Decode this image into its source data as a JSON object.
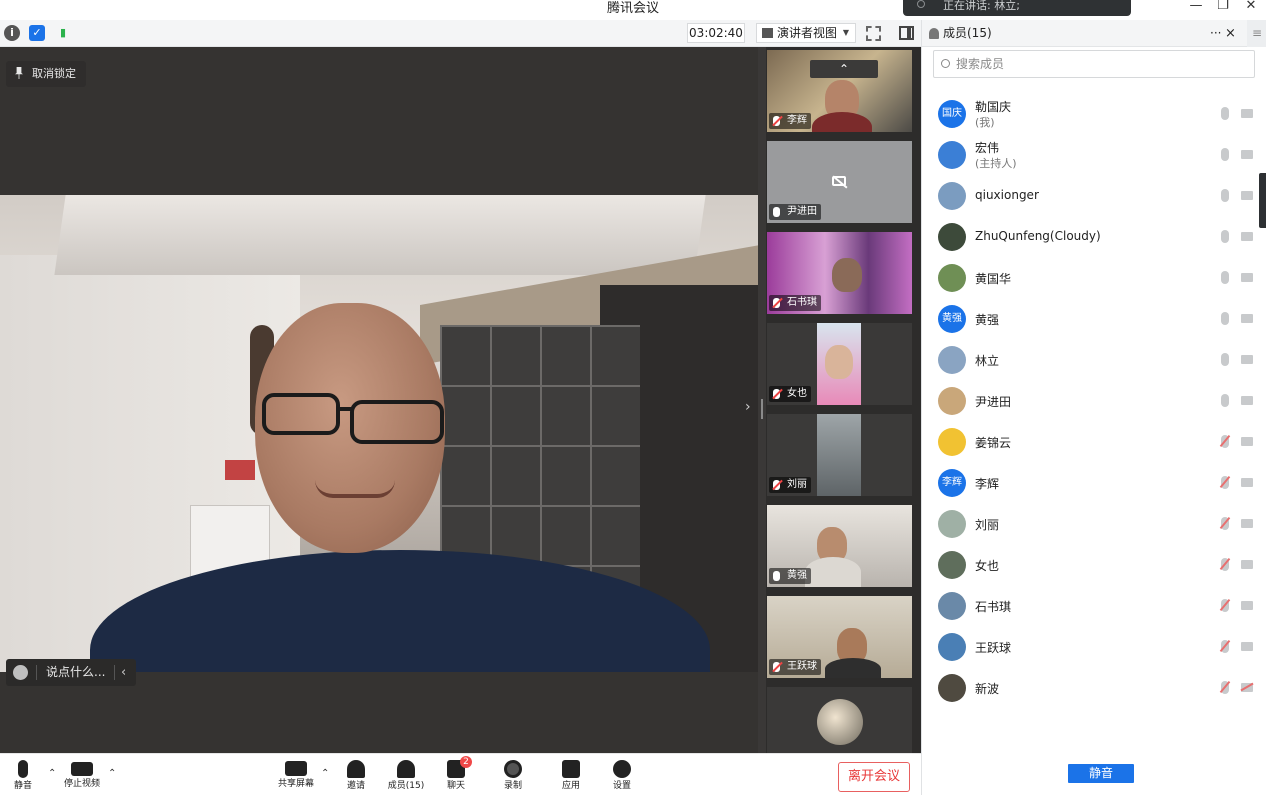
{
  "app": {
    "title": "腾讯会议",
    "speaking_text": "正在讲话: 林立;"
  },
  "toolbar": {
    "timer": "03:02:40",
    "view_mode": "演讲者视图"
  },
  "stage": {
    "unpin_label": "取消锁定",
    "chat_placeholder": "说点什么..."
  },
  "thumbnails": [
    {
      "name": "李辉",
      "mic": "muted"
    },
    {
      "name": "尹进田",
      "mic": "on"
    },
    {
      "name": "石书琪",
      "mic": "muted"
    },
    {
      "name": "女也",
      "mic": "muted"
    },
    {
      "name": "刘丽",
      "mic": "muted"
    },
    {
      "name": "黄强",
      "mic": "on"
    },
    {
      "name": "王跃球",
      "mic": "muted"
    },
    {
      "name": "",
      "mic": "on"
    }
  ],
  "bottombar": {
    "mute": "静音",
    "stop_video": "停止视频",
    "share_screen": "共享屏幕",
    "invite": "邀请",
    "members": "成员(15)",
    "chat": "聊天",
    "chat_badge": "2",
    "record": "录制",
    "apps": "应用",
    "settings": "设置",
    "leave": "离开会议"
  },
  "members_panel": {
    "title": "成员(15)",
    "more": "···",
    "close": "×",
    "menu": "≡",
    "search_placeholder": "搜索成员",
    "mute_all": "静音",
    "members": [
      {
        "name": "勒国庆",
        "role": "(我)",
        "avatar_text": "国庆",
        "avatar_color": "#1b73e8",
        "mic": "on"
      },
      {
        "name": "宏伟",
        "role": "(主持人)",
        "avatar_text": "",
        "avatar_color": "#3b7fd6",
        "mic": "on"
      },
      {
        "name": "qiuxionger",
        "role": "",
        "avatar_text": "",
        "avatar_color": "#7b9cc0",
        "mic": "on"
      },
      {
        "name": "ZhuQunfeng(Cloudy)",
        "role": "",
        "avatar_text": "",
        "avatar_color": "#3d4a3a",
        "mic": "on"
      },
      {
        "name": "黄国华",
        "role": "",
        "avatar_text": "",
        "avatar_color": "#6f8f55",
        "mic": "on"
      },
      {
        "name": "黄强",
        "role": "",
        "avatar_text": "黄强",
        "avatar_color": "#1b73e8",
        "mic": "on"
      },
      {
        "name": "林立",
        "role": "",
        "avatar_text": "",
        "avatar_color": "#8aa4c2",
        "mic": "on"
      },
      {
        "name": "尹进田",
        "role": "",
        "avatar_text": "",
        "avatar_color": "#c9a77a",
        "mic": "on"
      },
      {
        "name": "姜锦云",
        "role": "",
        "avatar_text": "",
        "avatar_color": "#f1c232",
        "mic": "muted"
      },
      {
        "name": "李辉",
        "role": "",
        "avatar_text": "李辉",
        "avatar_color": "#1b73e8",
        "mic": "muted"
      },
      {
        "name": "刘丽",
        "role": "",
        "avatar_text": "",
        "avatar_color": "#9fb0a5",
        "mic": "muted"
      },
      {
        "name": "女也",
        "role": "",
        "avatar_text": "",
        "avatar_color": "#5f6e5c",
        "mic": "muted"
      },
      {
        "name": "石书琪",
        "role": "",
        "avatar_text": "",
        "avatar_color": "#6a89a8",
        "mic": "muted"
      },
      {
        "name": "王跃球",
        "role": "",
        "avatar_text": "",
        "avatar_color": "#4a7fb5",
        "mic": "muted"
      },
      {
        "name": "新波",
        "role": "",
        "avatar_text": "",
        "avatar_color": "#4f4a40",
        "mic": "muted",
        "cam": "muted"
      }
    ]
  }
}
